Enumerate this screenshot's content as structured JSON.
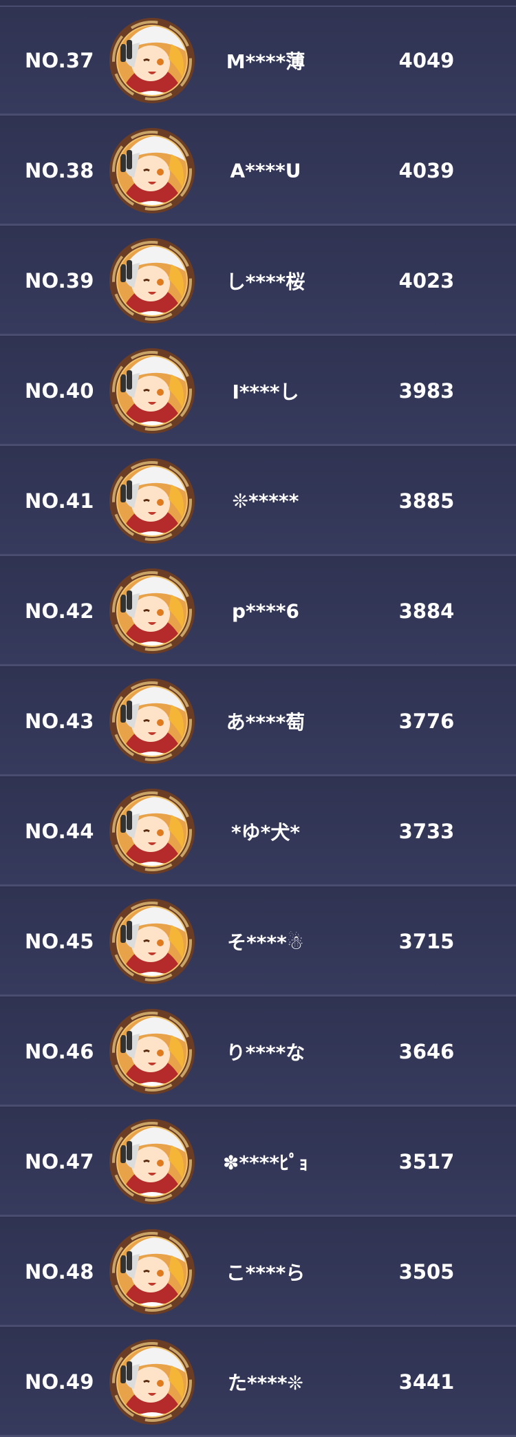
{
  "ranking": [
    {
      "rank": "NO.37",
      "name": "M****薄",
      "score": "4049",
      "avatar": "character-avatar-icon"
    },
    {
      "rank": "NO.38",
      "name": "A****U",
      "score": "4039",
      "avatar": "character-avatar-icon"
    },
    {
      "rank": "NO.39",
      "name": "し****桜",
      "score": "4023",
      "avatar": "character-avatar-icon"
    },
    {
      "rank": "NO.40",
      "name": "I****し",
      "score": "3983",
      "avatar": "character-avatar-icon"
    },
    {
      "rank": "NO.41",
      "name": "❊*****",
      "score": "3885",
      "avatar": "character-avatar-icon"
    },
    {
      "rank": "NO.42",
      "name": "p****6",
      "score": "3884",
      "avatar": "character-avatar-icon"
    },
    {
      "rank": "NO.43",
      "name": "あ****萄",
      "score": "3776",
      "avatar": "character-avatar-icon"
    },
    {
      "rank": "NO.44",
      "name": "*ゆ*犬*",
      "score": "3733",
      "avatar": "character-avatar-icon"
    },
    {
      "rank": "NO.45",
      "name": "そ****☃",
      "score": "3715",
      "avatar": "character-avatar-icon"
    },
    {
      "rank": "NO.46",
      "name": "り****な",
      "score": "3646",
      "avatar": "character-avatar-icon"
    },
    {
      "rank": "NO.47",
      "name": "✽****ﾋﾟｮ",
      "score": "3517",
      "avatar": "character-avatar-icon"
    },
    {
      "rank": "NO.48",
      "name": "こ****ら",
      "score": "3505",
      "avatar": "character-avatar-icon"
    },
    {
      "rank": "NO.49",
      "name": "た****❊",
      "score": "3441",
      "avatar": "character-avatar-icon"
    }
  ],
  "colors": {
    "background": "#2f3150",
    "row": "#343758",
    "divider": "#4a4d70",
    "text": "#ffffff",
    "avatar_ring": "#6b3d25",
    "avatar_gold": "#c9a468"
  }
}
